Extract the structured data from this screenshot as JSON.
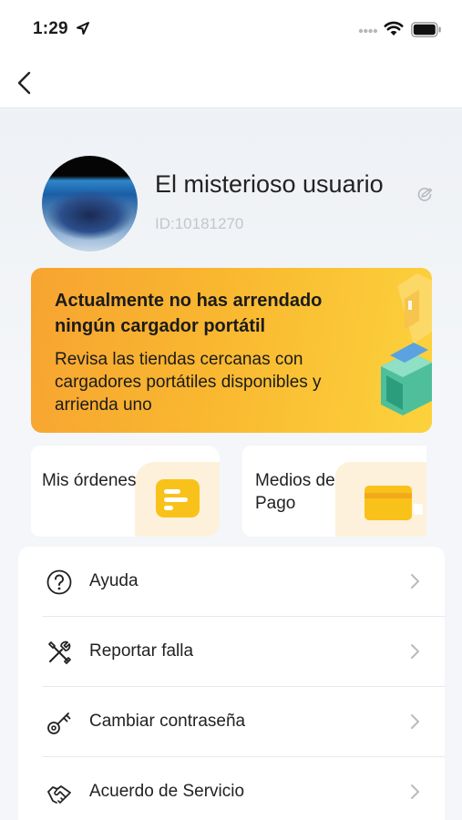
{
  "status_bar": {
    "time": "1:29"
  },
  "profile": {
    "name": "El misterioso usuario",
    "id": "ID:10181270"
  },
  "banner": {
    "title": "Actualmente no has arrendado ningún cargador portátil",
    "text": "Revisa las tiendas cercanas con cargadores portátiles disponibles y arrienda uno"
  },
  "tiles": {
    "orders_label": "Mis órdenes",
    "payment_label": "Medios de Pago"
  },
  "menu": {
    "items": [
      {
        "label": "Ayuda",
        "icon": "help-icon"
      },
      {
        "label": "Reportar falla",
        "icon": "tools-icon"
      },
      {
        "label": "Cambiar contraseña",
        "icon": "key-icon"
      },
      {
        "label": "Acuerdo de Servicio",
        "icon": "agreement-icon"
      }
    ]
  },
  "colors": {
    "banner_start": "#f7a431",
    "banner_end": "#fcd23c",
    "accent_yellow": "#f9c21a",
    "background": "#f4f6f9"
  }
}
